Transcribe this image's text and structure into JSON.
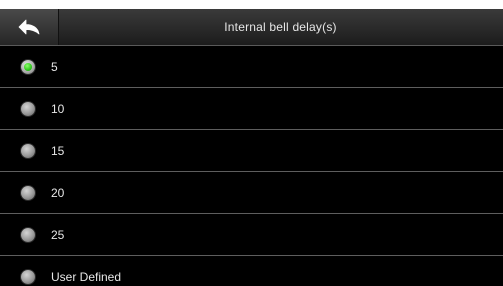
{
  "header": {
    "title": "Internal bell delay(s)",
    "back_icon": "back-arrow-icon"
  },
  "options": [
    {
      "label": "5",
      "selected": true
    },
    {
      "label": "10",
      "selected": false
    },
    {
      "label": "15",
      "selected": false
    },
    {
      "label": "20",
      "selected": false
    },
    {
      "label": "25",
      "selected": false
    },
    {
      "label": "User Defined",
      "selected": false
    }
  ],
  "colors": {
    "background": "#000000",
    "divider": "#5e5e5e",
    "text": "#e6e6e6",
    "selected_indicator": "#2fc81b"
  }
}
